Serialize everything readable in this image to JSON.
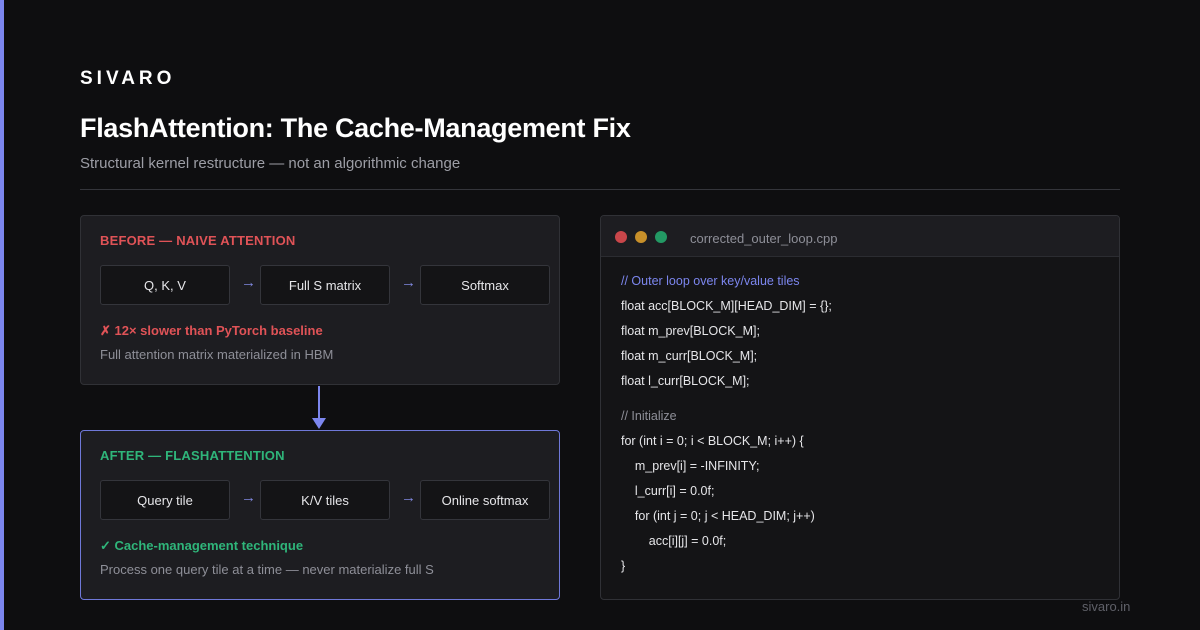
{
  "brand": "SIVARO",
  "title": "FlashAttention: The Cache-Management Fix",
  "subtitle": "Structural kernel restructure — not an algorithmic change",
  "colors": {
    "accent": "#7c86ee",
    "error": "#e05357",
    "success": "#2fb57a",
    "background": "#0e0e10"
  },
  "before": {
    "heading": "BEFORE — NAIVE ATTENTION",
    "steps": [
      "Q, K, V",
      "Full S matrix",
      "Softmax"
    ],
    "arrow": "→",
    "status": "✗ 12× slower than PyTorch baseline",
    "note": "Full attention matrix materialized in HBM"
  },
  "after": {
    "heading": "AFTER — FLASHATTENTION",
    "steps": [
      "Query tile",
      "K/V tiles",
      "Online softmax"
    ],
    "arrow": "→",
    "status": "✓ Cache-management technique",
    "note": "Process one query tile at a time — never materialize full S"
  },
  "editor": {
    "filename": "corrected_outer_loop.cpp",
    "lines": [
      "// Outer loop over key/value tiles",
      "float acc[BLOCK_M][HEAD_DIM] = {};",
      "float m_prev[BLOCK_M];",
      "float m_curr[BLOCK_M];",
      "float l_curr[BLOCK_M];",
      "// Initialize",
      "for (int i = 0; i < BLOCK_M; i++) {",
      "    m_prev[i] = -INFINITY;",
      "    l_curr[i] = 0.0f;",
      "    for (int j = 0; j < HEAD_DIM; j++)",
      "        acc[i][j] = 0.0f;",
      "}"
    ]
  },
  "footer": {
    "url": "sivaro.in"
  }
}
